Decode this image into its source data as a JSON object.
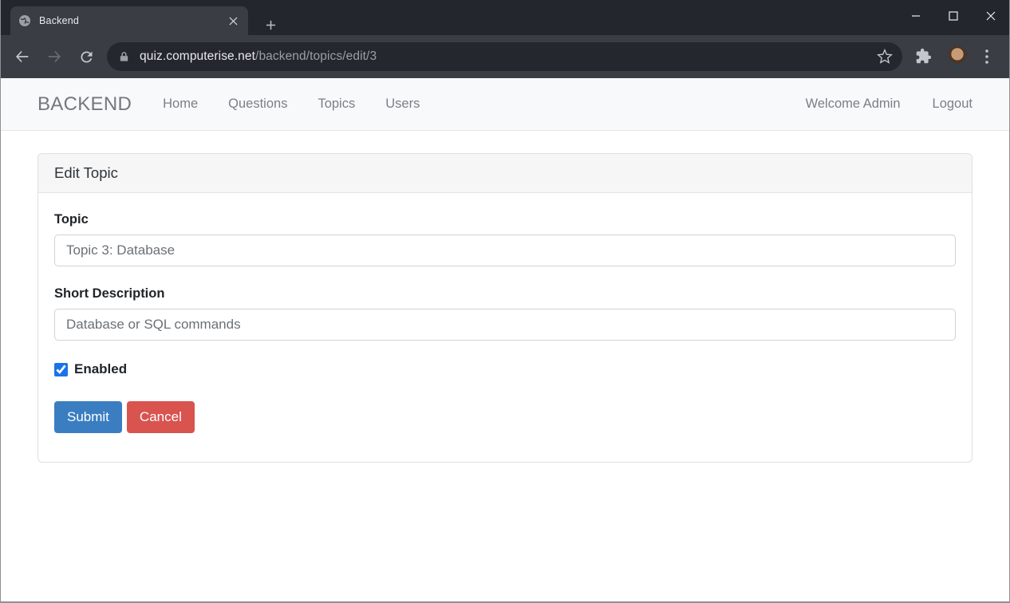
{
  "browser": {
    "tab": {
      "title": "Backend"
    },
    "url": {
      "domain": "quiz.computerise.net",
      "path": "/backend/topics/edit/3"
    }
  },
  "navbar": {
    "brand": "BACKEND",
    "items": [
      {
        "label": "Home"
      },
      {
        "label": "Questions"
      },
      {
        "label": "Topics"
      },
      {
        "label": "Users"
      }
    ],
    "welcome_text": "Welcome Admin",
    "logout_label": "Logout"
  },
  "page": {
    "card": {
      "header": "Edit Topic",
      "fields": [
        {
          "label": "Topic",
          "value": "Topic 3: Database"
        },
        {
          "label": "Short Description",
          "value": "Database or SQL commands"
        }
      ],
      "checkbox": {
        "label": "Enabled",
        "checked": true
      },
      "buttons": {
        "submit": "Submit",
        "cancel": "Cancel"
      }
    }
  },
  "icons": {
    "favicon": "globe-icon",
    "toolbar": [
      "back-arrow-icon",
      "forward-arrow-icon",
      "reload-icon",
      "lock-icon",
      "star-icon",
      "extensions-puzzle-icon",
      "profile-avatar",
      "kebab-menu-icon"
    ],
    "window": [
      "minimize-icon",
      "maximize-icon",
      "close-icon"
    ]
  },
  "colors": {
    "submit_blue": "#3a7ec1",
    "cancel_red": "#d9534f",
    "checkbox_blue": "#1a73e8",
    "navbar_bg": "#f8f9fa",
    "chrome_frame": "#23262c",
    "chrome_toolbar": "#3a3d44"
  }
}
